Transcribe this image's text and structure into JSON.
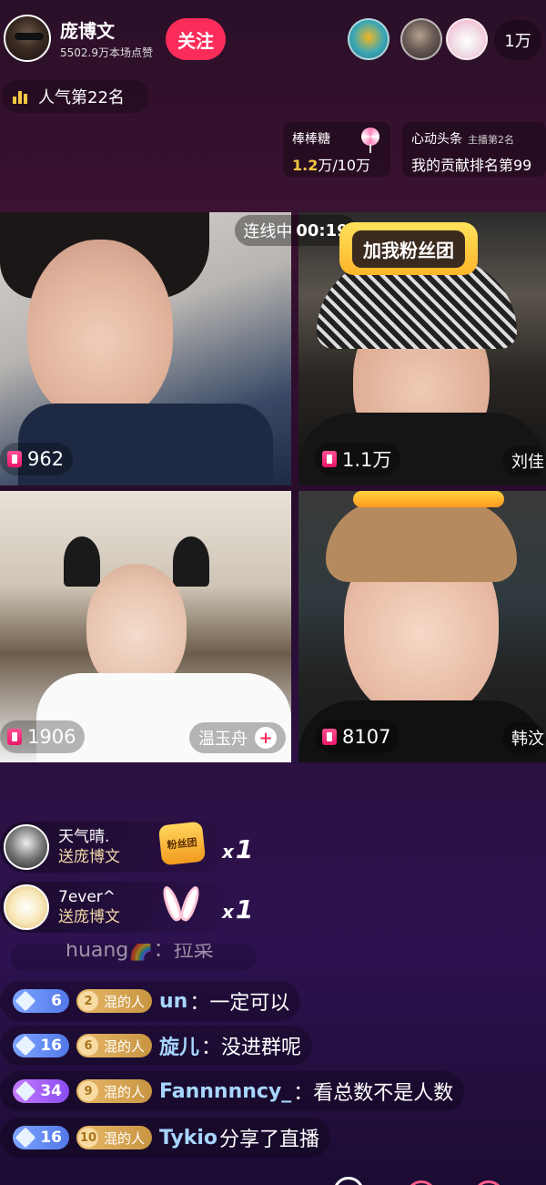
{
  "host": {
    "name": "庞博文",
    "likes": "5502.9万本场点赞",
    "follow_label": "关注"
  },
  "viewers": {
    "count": "1万"
  },
  "rank": {
    "label": "人气第22名"
  },
  "lollipop_card": {
    "title": "棒棒糖",
    "current": "1.2",
    "current_unit": "万",
    "target": "/10万"
  },
  "headline_card": {
    "title": "心动头条",
    "sub": "主播第2名",
    "value": "我的贡献排名第99"
  },
  "connect_status": {
    "label": "连线中",
    "time": "00:19"
  },
  "fan_badge": {
    "label": "加我粉丝团"
  },
  "tiles": [
    {
      "coins": "962"
    },
    {
      "coins": "1.1万",
      "name": "刘佳"
    },
    {
      "coins": "1906",
      "name": "温玉舟"
    },
    {
      "coins": "8107",
      "name": "韩汶"
    }
  ],
  "gifts": [
    {
      "user": "天气晴.",
      "to": "送庞博文",
      "item_label": "粉丝团",
      "multiplier": "1"
    },
    {
      "user": "7ever^",
      "to": "送庞博文",
      "multiplier": "1"
    }
  ],
  "chat_faded": "huang🌈：拉菜",
  "chat": [
    {
      "level": "6",
      "level_color": "#5278e8",
      "fan_level": "2",
      "fan_label": "混的人",
      "user": "un",
      "message": "：一定可以"
    },
    {
      "level": "16",
      "level_color": "#5278e8",
      "fan_level": "6",
      "fan_label": "混的人",
      "user": "旋儿",
      "message": "：没进群呢"
    },
    {
      "level": "34",
      "level_color": "#8a4cf0",
      "fan_level": "9",
      "fan_label": "混的人",
      "user": "Fannnnncy_",
      "message": "：看总数不是人数"
    },
    {
      "level": "16",
      "level_color": "#5278e8",
      "fan_level": "10",
      "fan_label": "混的人",
      "user": "Tykio",
      "message": " 分享了直播"
    }
  ],
  "icons": {
    "coin": "ticket-icon",
    "lollipop": "lollipop-icon",
    "rank": "bar-chart-icon",
    "gem": "diamond-icon",
    "plus": "plus-icon"
  }
}
